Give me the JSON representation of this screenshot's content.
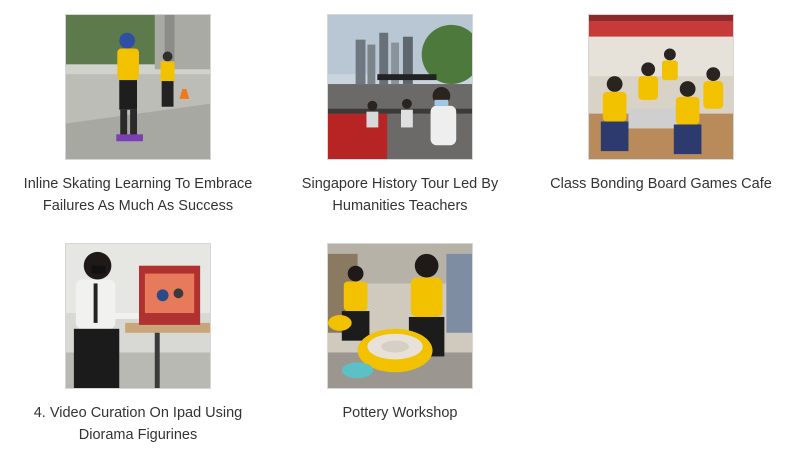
{
  "gallery": {
    "items": [
      {
        "caption": "Inline Skating Learning To Embrace Failures As Much As Success",
        "image": "photo-inline-skating"
      },
      {
        "caption": "Singapore History Tour Led By Humanities Teachers",
        "image": "photo-history-tour"
      },
      {
        "caption": "Class Bonding Board Games Cafe",
        "image": "photo-board-games"
      },
      {
        "caption": "4. Video Curation On Ipad Using Diorama Figurines",
        "image": "photo-video-curation"
      },
      {
        "caption": "Pottery Workshop",
        "image": "photo-pottery"
      }
    ]
  },
  "colors": {
    "caption_text": "#333333",
    "thumb_border": "#d6d6d6",
    "uniform_yellow": "#f2c200"
  }
}
